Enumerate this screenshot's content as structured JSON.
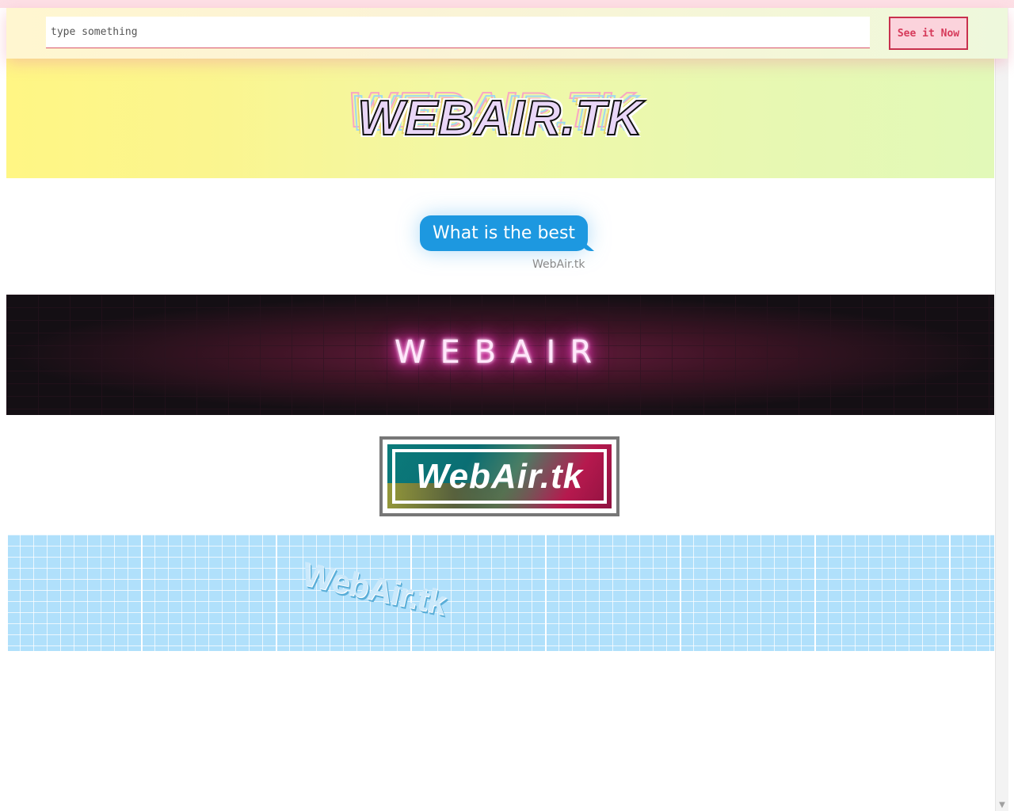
{
  "search": {
    "placeholder": "type something",
    "button_label": "See it Now"
  },
  "banners": {
    "sticker_logo": "WEBAIR.TK",
    "bubble_text": "What is the best",
    "bubble_caption": "WebAir.tk",
    "neon_text": "WEBAIR",
    "framed_logo": "WebAir.tk",
    "grid_logo": "WebAir.tk"
  },
  "colors": {
    "accent": "#d63a5a",
    "bubble": "#1d98e0",
    "grid": "#b0e0fb"
  }
}
